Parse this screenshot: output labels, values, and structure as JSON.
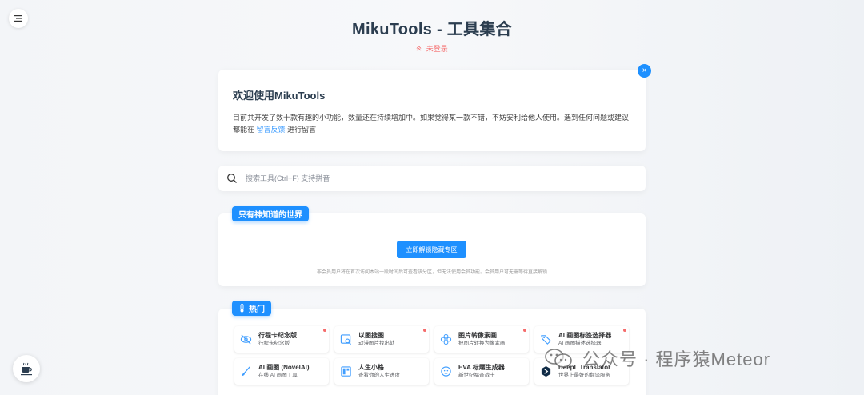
{
  "page": {
    "title": "MikuTools - 工具集合",
    "login_status": "未登录"
  },
  "welcome": {
    "heading": "欢迎使用MikuTools",
    "text_before": "目前共开发了数十款有趣的小功能，数量还在持续增加中。如果觉得某一款不错，不妨安利给他人使用。遇到任何问题或建议都能在",
    "link": "留言反馈",
    "text_after": "进行留言",
    "close_label": "×"
  },
  "search": {
    "placeholder": "搜索工具(Ctrl+F) 支持拼音"
  },
  "secret": {
    "tag": "只有神知道的世界",
    "button": "立即解锁隐藏专区",
    "note": "非会员用户将在首次访问本站一段时间后可查看该分区，但无法使用会员功能。会员用户可无需等待直接解锁"
  },
  "hot": {
    "tag": "热门",
    "tools": [
      {
        "name": "行程卡纪念版",
        "desc": "行程卡纪念版",
        "icon": "eye-off-icon",
        "dot": true
      },
      {
        "name": "以图搜图",
        "desc": "动漫图片找出处",
        "icon": "image-search-icon",
        "dot": true
      },
      {
        "name": "图片转像素画",
        "desc": "把图片转换为像素画",
        "icon": "flower-icon",
        "dot": true
      },
      {
        "name": "AI 画图标签选择器",
        "desc": "AI 画图描述选择器",
        "icon": "tag-icon",
        "dot": true
      },
      {
        "name": "AI 画图 (NovelAI)",
        "desc": "在线 AI 画图工具",
        "icon": "brush-icon",
        "dot": false
      },
      {
        "name": "人生小格",
        "desc": "查看你的人生进度",
        "icon": "grid-icon",
        "dot": false
      },
      {
        "name": "EVA 标题生成器",
        "desc": "新世纪福音战士",
        "icon": "face-icon",
        "dot": false
      },
      {
        "name": "DeepL Translator",
        "desc": "世界上最好的翻译服务",
        "icon": "deepl-icon",
        "dot": false
      }
    ]
  },
  "watermark": {
    "text": "公众号 · 程序猿Meteor"
  },
  "colors": {
    "accent": "#1e90ff",
    "danger": "#f56c6c"
  }
}
